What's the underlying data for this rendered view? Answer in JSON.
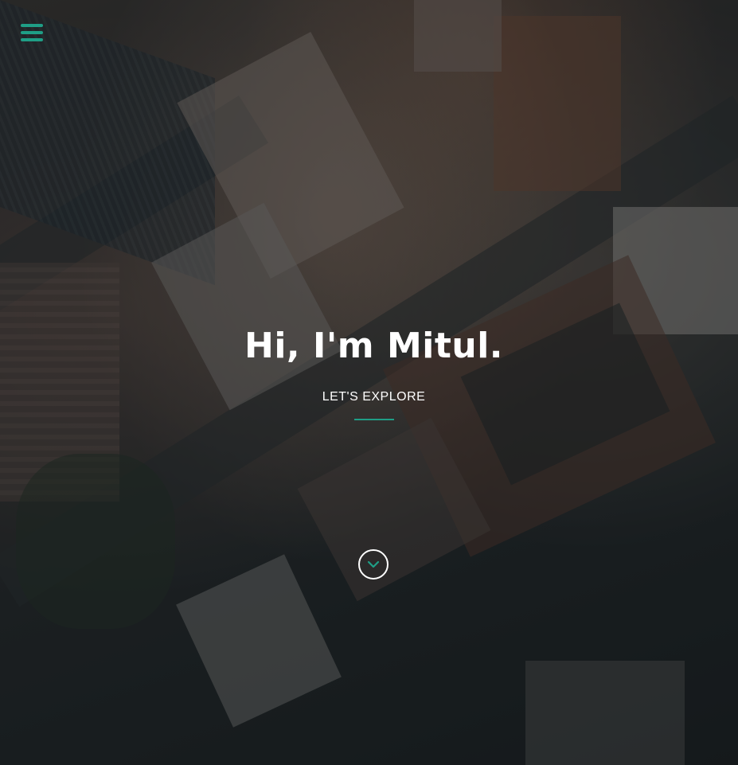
{
  "hero": {
    "title": "Hi, I'm Mitul.",
    "cta_label": "LET'S EXPLORE"
  },
  "icons": {
    "menu": "hamburger-menu-icon",
    "scroll_down": "chevron-down-icon"
  },
  "colors": {
    "accent": "#1f9e86",
    "text": "#ffffff",
    "overlay": "#14181a"
  }
}
